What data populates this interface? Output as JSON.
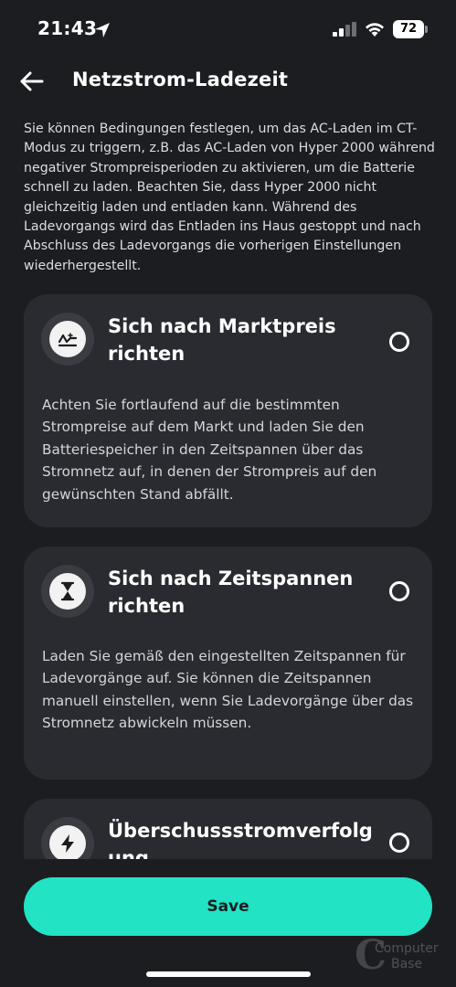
{
  "status_bar": {
    "time": "21:43",
    "battery": "72"
  },
  "header": {
    "title": "Netzstrom-Ladezeit",
    "back_icon": "arrow-left-icon"
  },
  "intro_text": "Sie können Bedingungen festlegen, um das AC-Laden im CT-Modus zu triggern, z.B. das AC-Laden von Hyper 2000 während negativer Strompreisperioden zu aktivieren, um die Batterie schnell zu laden. Beachten Sie, dass Hyper 2000 nicht gleichzeitig laden und entladen kann. Während des Ladevorgangs wird das Entladen ins Haus gestoppt und nach Abschluss des Ladevorgangs die vorherigen Einstellungen wiederhergestellt.",
  "options": [
    {
      "icon": "price-chart-icon",
      "title": "Sich nach Marktpreis richten",
      "description": "Achten Sie fortlaufend auf die bestimmten Strompreise auf dem Markt und laden Sie den Batteriespeicher in den Zeitspannen über das Stromnetz auf, in denen der Strompreis auf den gewünschten Stand abfällt.",
      "selected": false
    },
    {
      "icon": "hourglass-icon",
      "title": "Sich nach Zeitspannen richten",
      "description": "Laden Sie gemäß den eingestellten Zeitspannen für Ladevorgänge auf. Sie können die Zeitspannen manuell einstellen, wenn Sie Ladevorgänge über das Stromnetz abwickeln müssen.",
      "selected": false
    },
    {
      "icon": "lightning-icon",
      "title": "Überschussstromverfolgung",
      "selected": false
    }
  ],
  "save_label": "Save",
  "watermark": {
    "line1": "Computer",
    "line2": "Base"
  },
  "colors": {
    "background": "#1c1d21",
    "card": "#2a2b30",
    "accent": "#22e3c4"
  }
}
